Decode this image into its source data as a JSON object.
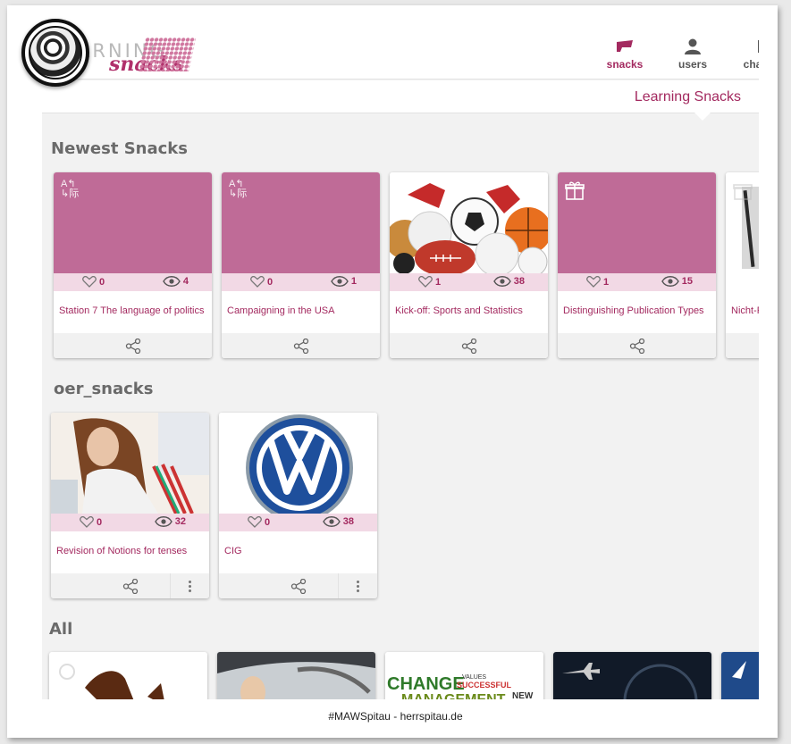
{
  "header": {
    "logo_text": "LEARNING",
    "logo_script": "snacks",
    "nav": [
      {
        "label": "snacks",
        "icon": "snack-icon"
      },
      {
        "label": "users",
        "icon": "user-icon"
      },
      {
        "label": "cha",
        "icon": "chat-icon"
      }
    ],
    "subtitle": "Learning Snacks"
  },
  "sections": {
    "newest": {
      "title": "Newest Snacks",
      "cards": [
        {
          "title": "Station 7 The language of politics",
          "likes": "0",
          "views": "4",
          "icon": "translate-icon"
        },
        {
          "title": "Campaigning in the USA",
          "likes": "0",
          "views": "1",
          "icon": "translate-icon"
        },
        {
          "title": "Kick-off: Sports and Statistics",
          "likes": "1",
          "views": "38",
          "icon": "sports-balls-image"
        },
        {
          "title": "Distinguishing Publication Types",
          "likes": "1",
          "views": "15",
          "icon": "gift-icon"
        },
        {
          "title": "Nicht-F",
          "likes": "",
          "views": "",
          "icon": "gift-icon"
        }
      ]
    },
    "oer": {
      "title": "oer_snacks",
      "cards": [
        {
          "title": "Revision of Notions for tenses",
          "likes": "0",
          "views": "32",
          "icon": "student-photo"
        },
        {
          "title": "CIG",
          "likes": "0",
          "views": "38",
          "icon": "vw-logo"
        }
      ]
    },
    "all": {
      "title": "All"
    }
  },
  "footer": "#MAWSpitau - herrspitau.de",
  "colors": {
    "accent": "#a3295f",
    "card_header": "#bf6b97",
    "background": "#f2f2f2"
  }
}
